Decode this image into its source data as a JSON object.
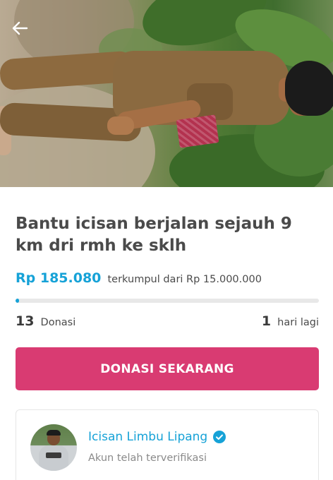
{
  "campaign": {
    "title": "Bantu icisan berjalan sejauh 9 km dri rmh ke sklh",
    "collected": "Rp 185.080",
    "collected_suffix": "terkumpul dari Rp 15.000.000",
    "progress_fraction": 0.0123,
    "donations_count": "13",
    "donations_label": "Donasi",
    "days_left": "1",
    "days_left_label": "hari lagi"
  },
  "actions": {
    "donate_label": "DONASI SEKARANG",
    "back_icon": "arrow-left-icon"
  },
  "organizer": {
    "name": "Icisan Limbu Lipang",
    "status": "Akun telah terverifikasi",
    "verified_icon": "check-badge-icon"
  },
  "colors": {
    "accent": "#16a2d7",
    "donate_button": "#d93b72",
    "progress_track": "#e8e8e8"
  }
}
